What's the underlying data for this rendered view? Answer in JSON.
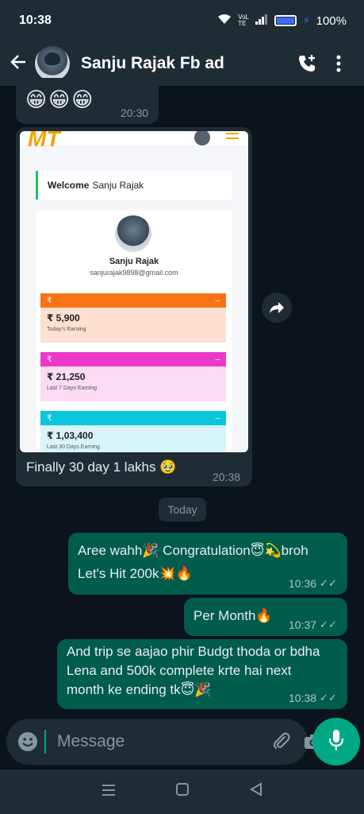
{
  "status_bar": {
    "time": "10:38",
    "battery_pct": "100%",
    "network": "VoLTE"
  },
  "header": {
    "contact_name": "Sanju Rajak Fb ad"
  },
  "messages": {
    "emoji_msg": {
      "text": "😁😁😁",
      "time": "20:30"
    },
    "image_msg": {
      "screenshot": {
        "welcome_bold": "Welcome",
        "welcome_name": "Sanju Rajak",
        "profile_name": "Sanju Rajak",
        "profile_email": "sanjurajak9898@gmail.com",
        "cards": [
          {
            "symbol": "₹",
            "amount": "₹ 5,900",
            "label": "Today's Earning",
            "bar_color": "#f97316",
            "bg_color": "#fde0cf"
          },
          {
            "symbol": "₹",
            "amount": "₹ 21,250",
            "label": "Last 7 Days Earning",
            "bar_color": "#ec38c9",
            "bg_color": "#fbdcf3"
          },
          {
            "symbol": "₹",
            "amount": "₹ 1,03,400",
            "label": "Last 30 Days Earning",
            "bar_color": "#0bc5dc",
            "bg_color": "#d7f4f8"
          }
        ]
      },
      "caption": "Finally 30 day 1 lakhs 🥹",
      "time": "20:38"
    },
    "date_divider": "Today",
    "out1": {
      "line1": "Aree wahh🎉 Congratulation😇💫broh",
      "line2": "Let's Hit 200k💥🔥",
      "time": "10:36"
    },
    "out2": {
      "text": "Per Month🔥",
      "time": "10:37"
    },
    "out3": {
      "line1": "And trip se aajao phir Budgt thoda or bdha",
      "line2": "Lena and 500k complete krte hai next",
      "line3": "month ke ending tk😇🎉",
      "time": "10:38"
    }
  },
  "input": {
    "placeholder": "Message"
  },
  "colors": {
    "outgoing_bubble": "#005c4b",
    "incoming_bubble": "#1f2c34",
    "accent": "#00a884"
  }
}
